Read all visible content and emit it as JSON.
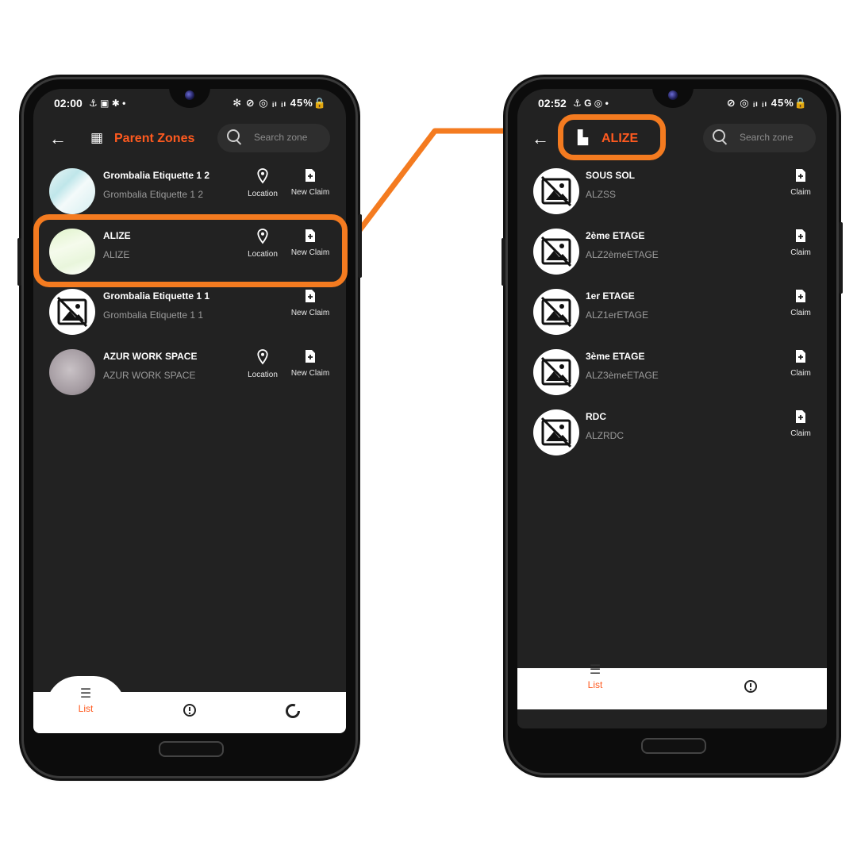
{
  "left_phone": {
    "status": {
      "time": "02:00",
      "left_icons": "⚓ ▣ ✱ •",
      "right_icons": "✻ ⊘ ◎ ᵢₗ ᵢₗ 45%🔒"
    },
    "header": {
      "title": "Parent Zones",
      "search_placeholder": "Search zone"
    },
    "rows": [
      {
        "title": "Grombalia Etiquette 1 2",
        "subtitle": "Grombalia Etiquette 1 2",
        "location_label": "Location",
        "claim_label": "New Claim"
      },
      {
        "title": "ALIZE",
        "subtitle": "ALIZE",
        "location_label": "Location",
        "claim_label": "New Claim"
      },
      {
        "title": "Grombalia Etiquette 1 1",
        "subtitle": "Grombalia Etiquette 1 1",
        "claim_label": "New Claim"
      },
      {
        "title": "AZUR WORK SPACE",
        "subtitle": "AZUR WORK SPACE",
        "location_label": "Location",
        "claim_label": "New Claim"
      }
    ],
    "bottom_nav": {
      "list_label": "List"
    }
  },
  "right_phone": {
    "status": {
      "time": "02:52",
      "left_icons": "⚓ G ◎ •",
      "right_icons": "⊘ ◎ ᵢₗ ᵢₗ 45%🔒"
    },
    "header": {
      "title": "ALIZE",
      "search_placeholder": "Search zone"
    },
    "rows": [
      {
        "title": "SOUS SOL",
        "subtitle": "ALZSS",
        "claim_label": "Claim"
      },
      {
        "title": "2ème ETAGE",
        "subtitle": "ALZ2èmeETAGE",
        "claim_label": "Claim"
      },
      {
        "title": "1er ETAGE",
        "subtitle": "ALZ1erETAGE",
        "claim_label": "Claim"
      },
      {
        "title": "3ème ETAGE",
        "subtitle": "ALZ3èmeETAGE",
        "claim_label": "Claim"
      },
      {
        "title": "RDC",
        "subtitle": "ALZRDC",
        "claim_label": "Claim"
      }
    ],
    "bottom_nav": {
      "list_label": "List"
    }
  },
  "colors": {
    "accent": "#ff5a1f",
    "highlight": "#f47b20",
    "screen_bg": "#222222"
  }
}
